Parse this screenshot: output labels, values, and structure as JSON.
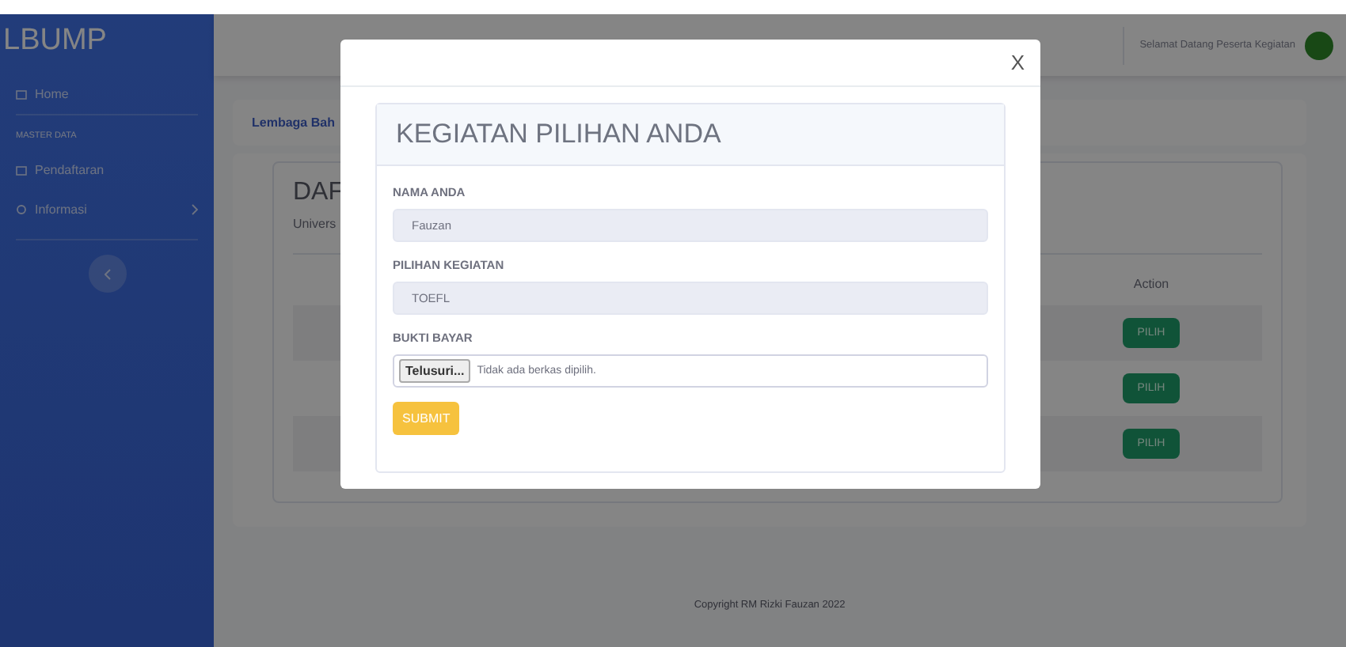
{
  "sidebar": {
    "brand": "LBUMP",
    "items": [
      {
        "kind": "link",
        "label": "Home"
      },
      {
        "kind": "heading",
        "label": "MASTER DATA"
      },
      {
        "kind": "link",
        "label": "Pendaftaran"
      },
      {
        "kind": "menu",
        "label": "Informasi"
      }
    ]
  },
  "topbar": {
    "greeting": "Selamat Datang Peserta Kegiatan"
  },
  "breadcrumb": {
    "text": "Lembaga Bah"
  },
  "card": {
    "title": "DAF",
    "subtitle": "Univers",
    "table": {
      "columns": [
        "Action"
      ],
      "rows": [
        {
          "action": "PILIH"
        },
        {
          "action": "PILIH"
        },
        {
          "action": "PILIH"
        }
      ]
    }
  },
  "footer": {
    "copyright": "Copyright RM Rizki Fauzan 2022"
  },
  "modal": {
    "close": "X",
    "title": "KEGIATAN PILIHAN ANDA",
    "fields": [
      {
        "kind": "text",
        "label": "NAMA ANDA",
        "value": "Fauzan",
        "readonly": true
      },
      {
        "kind": "text",
        "label": "PILIHAN KEGIATAN",
        "value": "TOEFL",
        "readonly": true
      },
      {
        "kind": "file",
        "label": "BUKTI BAYAR",
        "button": "Telusuri...",
        "status": "Tidak ada berkas dipilih."
      }
    ],
    "submit": "SUBMIT"
  }
}
